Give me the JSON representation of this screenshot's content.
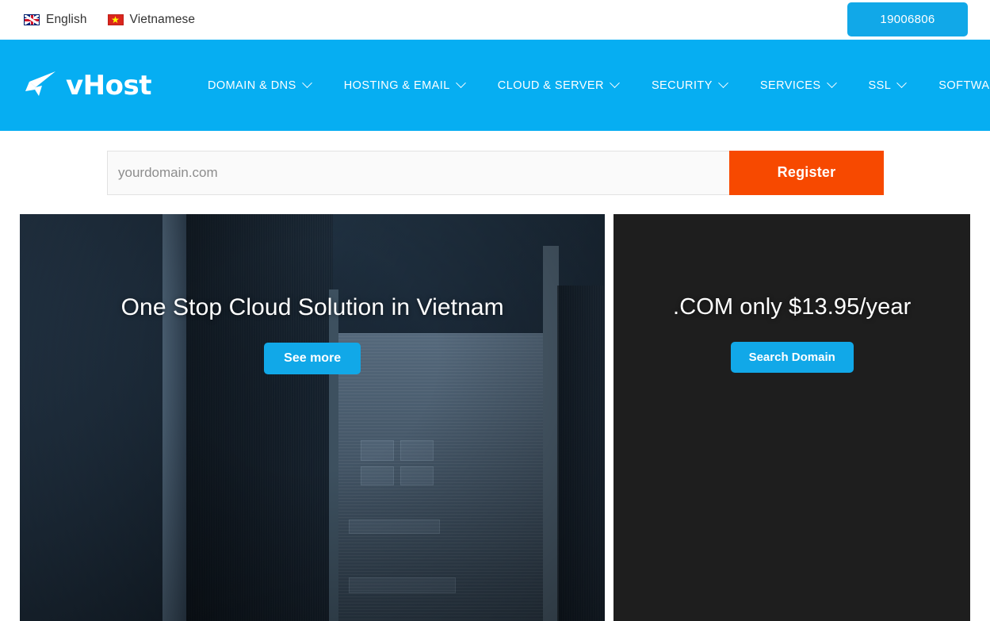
{
  "topbar": {
    "languages": [
      {
        "label": "English",
        "flag": "uk-flag-icon"
      },
      {
        "label": "Vietnamese",
        "flag": "vietnam-flag-icon"
      }
    ],
    "phone": "19006806"
  },
  "nav": {
    "logo_text": "vHost",
    "logo_icon": "vhost-arrow-logo-icon",
    "items": [
      {
        "label": "DOMAIN & DNS",
        "icon": "chevron-down-icon"
      },
      {
        "label": "HOSTING & EMAIL",
        "icon": "chevron-down-icon"
      },
      {
        "label": "CLOUD & SERVER",
        "icon": "chevron-down-icon"
      },
      {
        "label": "SECURITY",
        "icon": "chevron-down-icon"
      },
      {
        "label": "SERVICES",
        "icon": "chevron-down-icon"
      },
      {
        "label": "SSL",
        "icon": "chevron-down-icon"
      },
      {
        "label": "SOFTWARE",
        "icon": "chevron-down-icon"
      }
    ]
  },
  "search": {
    "placeholder": "yourdomain.com",
    "value": "",
    "button_label": "Register"
  },
  "hero": {
    "left": {
      "title": "One Stop Cloud Solution in Vietnam",
      "cta_label": "See more"
    },
    "right": {
      "title": ".COM only $13.95/year",
      "cta_label": "Search Domain"
    }
  },
  "colors": {
    "brand_blue": "#06aef2",
    "button_blue": "#11a8e8",
    "register_orange": "#f74900",
    "dark_card": "#1e1e1e",
    "photo_dark": "#1f2c38"
  }
}
